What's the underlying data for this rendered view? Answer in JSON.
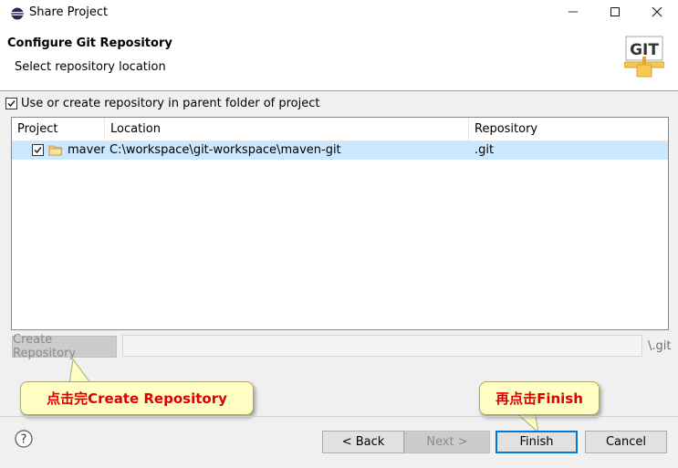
{
  "window": {
    "title": "Share Project",
    "controls": {
      "minimize": "—",
      "maximize": "☐",
      "close": "✕"
    }
  },
  "header": {
    "title": "Configure Git Repository",
    "subtitle": "Select repository location",
    "logo_text": "GIT"
  },
  "use_parent_checkbox": {
    "label": "Use or create repository in parent folder of project",
    "checked": true
  },
  "table": {
    "columns": [
      "Project",
      "Location",
      "Repository"
    ],
    "rows": [
      {
        "project": "maven-",
        "location": "C:\\workspace\\git-workspace\\maven-git",
        "repository": ".git",
        "checked": true,
        "selected": true
      }
    ]
  },
  "create_repository": {
    "button_label": "Create Repository",
    "path_value": "",
    "suffix": "\\.git"
  },
  "callouts": {
    "left": "点击完Create Repository",
    "right": "再点击Finish"
  },
  "footer": {
    "help_icon": "?",
    "back_label": "< Back",
    "next_label": "Next >",
    "finish_label": "Finish",
    "cancel_label": "Cancel"
  },
  "colors": {
    "selection": "#cce8ff",
    "callout_bg": "#ffffc4",
    "callout_text": "#e00000",
    "primary_border": "#0078d7"
  }
}
